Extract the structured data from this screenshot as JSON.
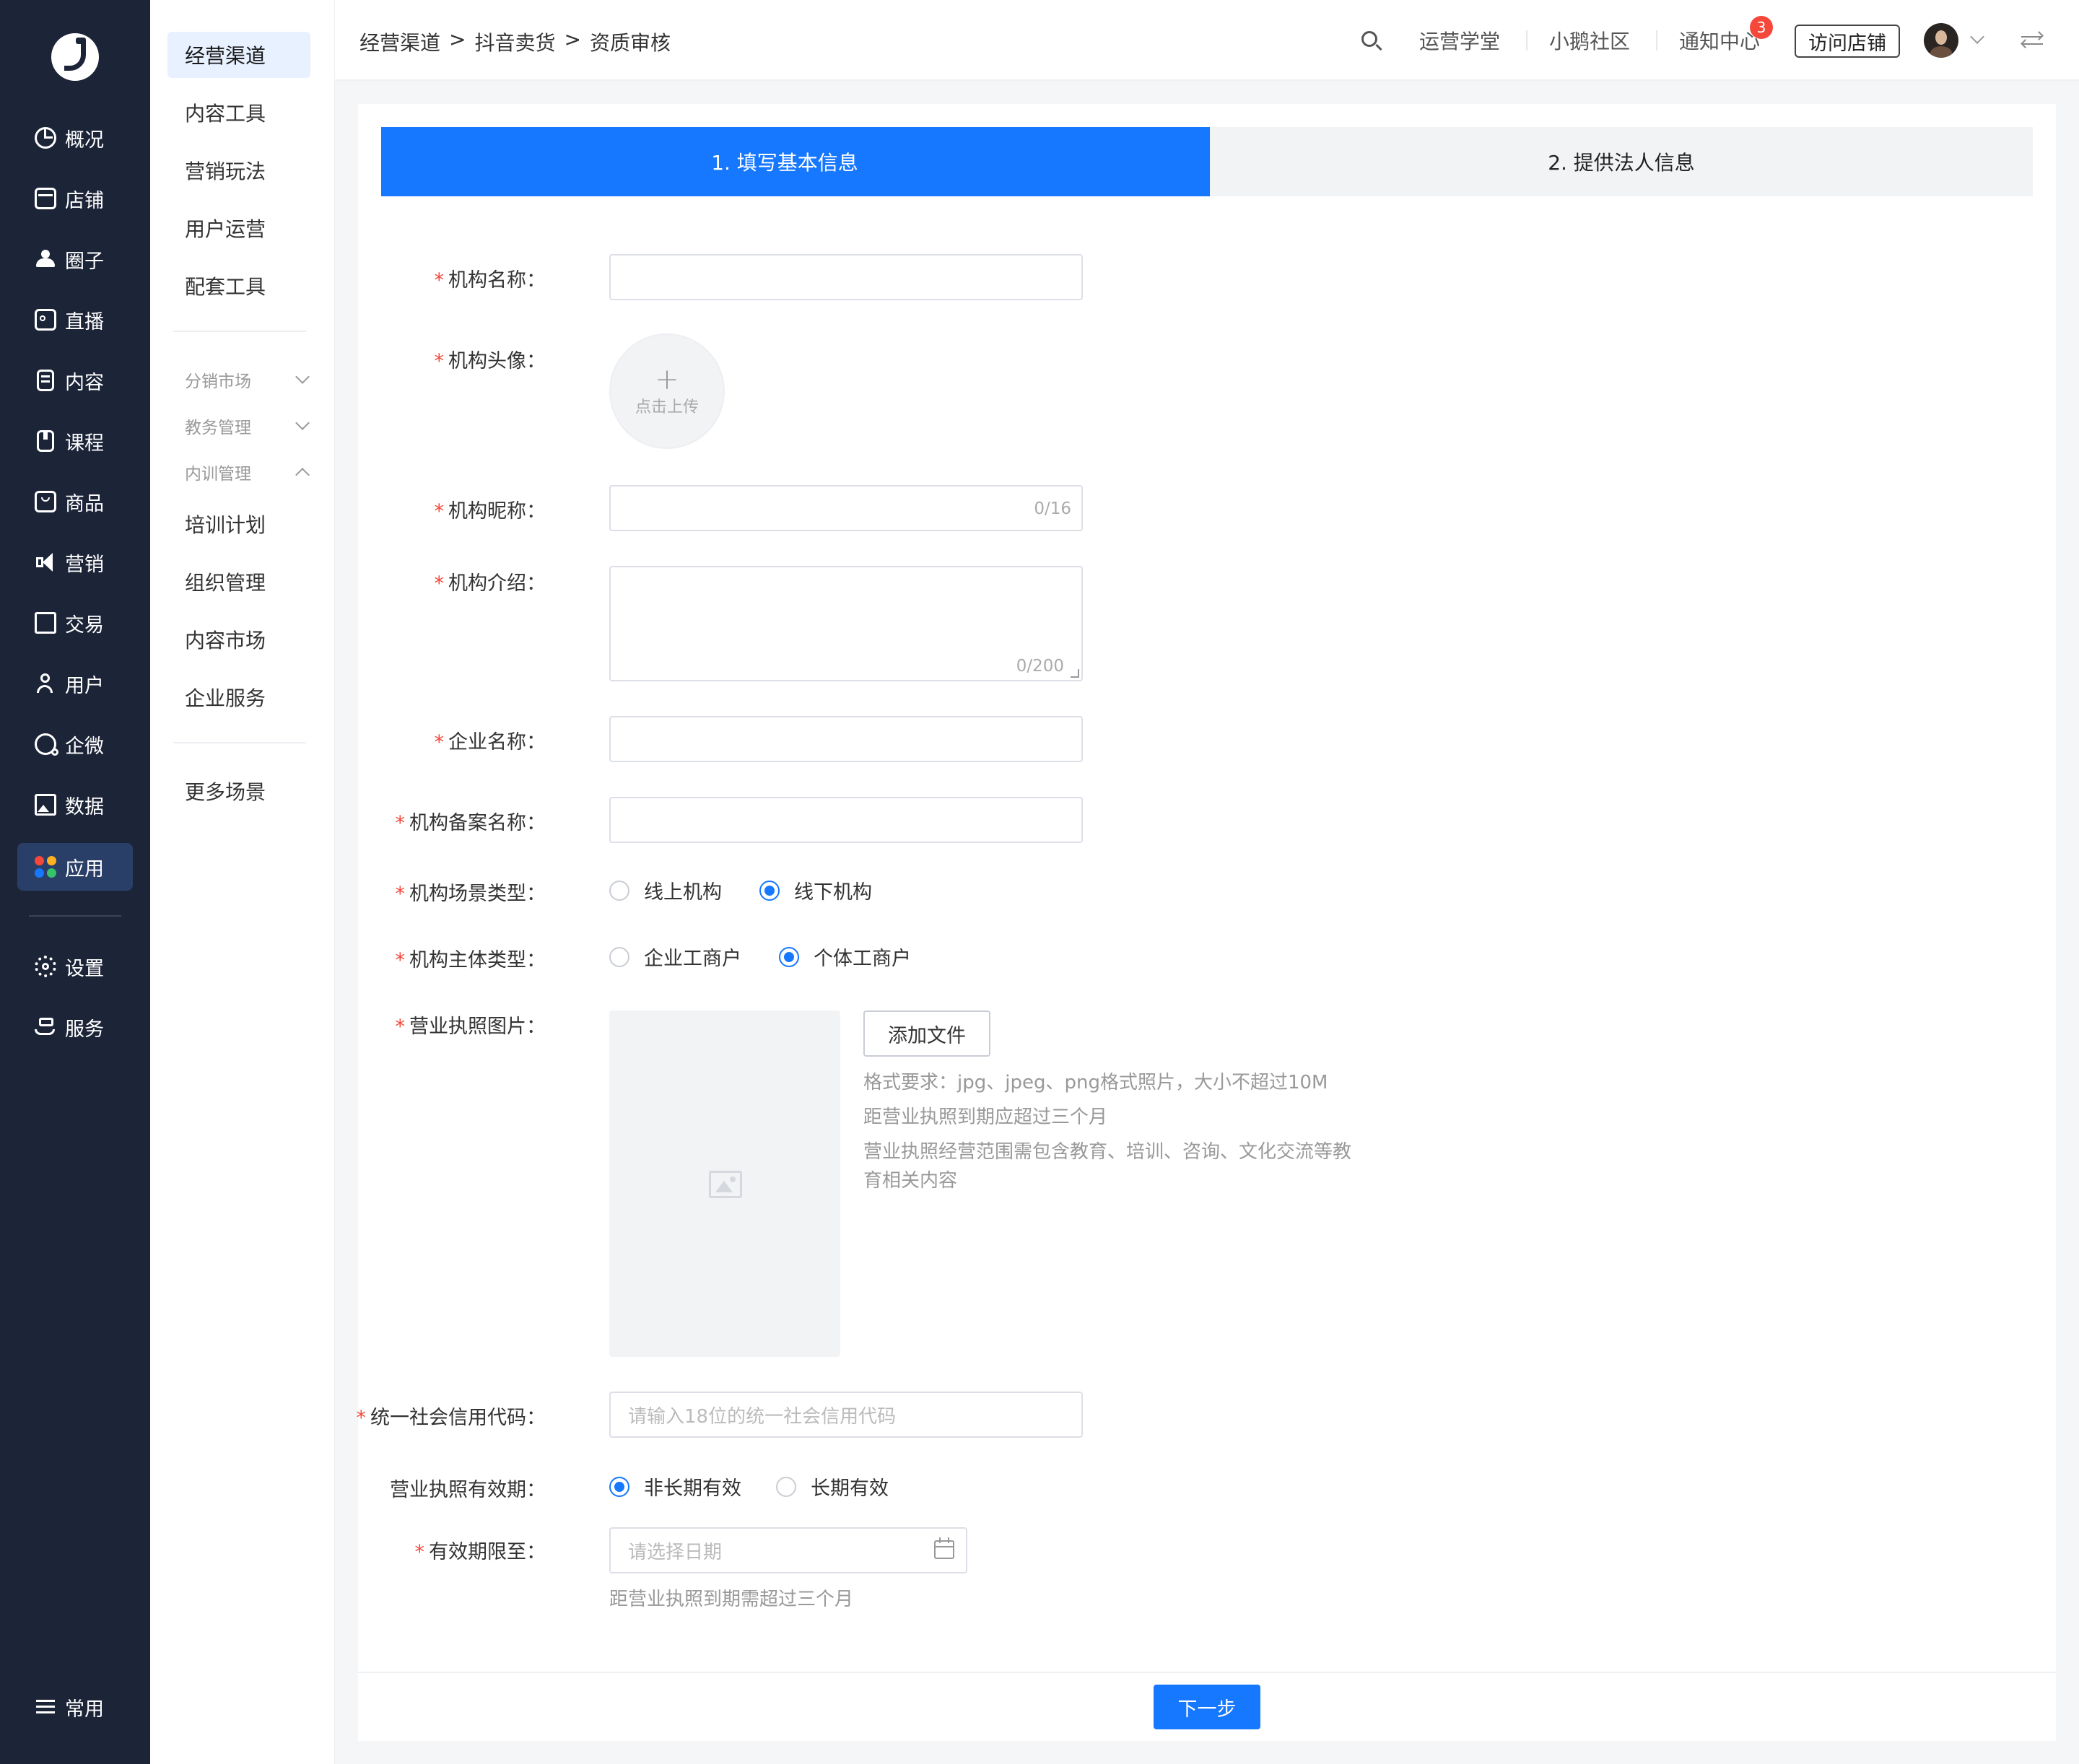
{
  "nav": {
    "items": [
      {
        "label": "概况",
        "icon": "chart-pie-icon"
      },
      {
        "label": "店铺",
        "icon": "store-icon"
      },
      {
        "label": "圈子",
        "icon": "group-icon"
      },
      {
        "label": "直播",
        "icon": "live-camera-icon"
      },
      {
        "label": "内容",
        "icon": "document-icon"
      },
      {
        "label": "课程",
        "icon": "book-icon"
      },
      {
        "label": "商品",
        "icon": "goods-box-icon"
      },
      {
        "label": "营销",
        "icon": "megaphone-icon"
      },
      {
        "label": "交易",
        "icon": "square-icon"
      },
      {
        "label": "用户",
        "icon": "user-icon"
      },
      {
        "label": "企微",
        "icon": "wecom-icon"
      },
      {
        "label": "数据",
        "icon": "data-image-icon"
      },
      {
        "label": "应用",
        "icon": "apps-icon"
      },
      {
        "label": "设置",
        "icon": "gear-icon"
      },
      {
        "label": "服务",
        "icon": "service-hand-icon"
      },
      {
        "label": "常用",
        "icon": "list-icon"
      }
    ],
    "active": "应用"
  },
  "submenu": {
    "items_top": [
      "经营渠道",
      "内容工具",
      "营销玩法",
      "用户运营",
      "配套工具"
    ],
    "groups": [
      "分销市场",
      "教务管理",
      "内训管理"
    ],
    "items_mid": [
      "培训计划",
      "组织管理",
      "内容市场",
      "企业服务"
    ],
    "items_bottom": [
      "更多场景"
    ]
  },
  "breadcrumb": [
    "经营渠道",
    ">",
    "抖音卖货",
    ">",
    "资质审核"
  ],
  "topbar": {
    "academy": "运营学堂",
    "community": "小鹅社区",
    "notifications": "通知中心",
    "notification_count": "3",
    "visit_store": "访问店铺"
  },
  "steps": {
    "step1": "1. 填写基本信息",
    "step2": "2. 提供法人信息"
  },
  "form": {
    "org_name_label": "机构名称：",
    "org_avatar_label": "机构头像：",
    "upload_label": "点击上传",
    "org_nickname_label": "机构昵称：",
    "org_nickname_count": "0/16",
    "org_intro_label": "机构介绍：",
    "org_intro_count": "0/200",
    "company_name_label": "企业名称：",
    "org_record_name_label": "机构备案名称：",
    "scene_type_label": "机构场景类型：",
    "scene_options": [
      "线上机构",
      "线下机构"
    ],
    "scene_selected": "线下机构",
    "entity_type_label": "机构主体类型：",
    "entity_options": [
      "企业工商户",
      "个体工商户"
    ],
    "entity_selected": "个体工商户",
    "license_image_label": "营业执照图片：",
    "add_file": "添加文件",
    "hints": [
      "格式要求：jpg、jpeg、png格式照片，大小不超过10M",
      "距营业执照到期应超过三个月",
      "营业执照经营范围需包含教育、培训、咨询、文化交流等教育相关内容"
    ],
    "credit_code_label": "统一社会信用代码：",
    "credit_code_placeholder": "请输入18位的统一社会信用代码",
    "validity_label": "营业执照有效期：",
    "validity_options": [
      "非长期有效",
      "长期有效"
    ],
    "validity_selected": "非长期有效",
    "expiry_label": "有效期限至：",
    "expiry_placeholder": "请选择日期",
    "expiry_hint": "距营业执照到期需超过三个月",
    "next": "下一步"
  },
  "colors": {
    "primary": "#1677ff",
    "nav_bg": "#1c2438",
    "required": "#f5483b"
  }
}
